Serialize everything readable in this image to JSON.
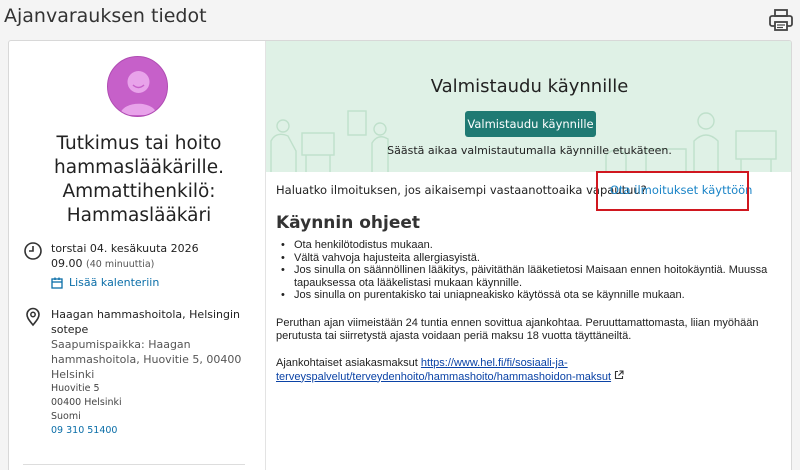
{
  "page": {
    "title": "Ajanvarauksen tiedot"
  },
  "professional": {
    "title": "Tutkimus tai hoito hammaslääkärille. Ammattihenkilö: Hammaslääkäri"
  },
  "appointment": {
    "date": "torstai 04. kesäkuuta 2026",
    "time": "09.00",
    "duration": "(40 minuuttia)",
    "add_calendar": "Lisää kalenteriin"
  },
  "location": {
    "name": "Haagan hammashoitola, Helsingin sotepe",
    "visit_place": "Saapumispaikka: Haagan hammashoitola, Huovitie 5, 00400 Helsinki",
    "street": "Huovitie 5",
    "postal": "00400 Helsinki",
    "country": "Suomi",
    "phone": "09 310 51400"
  },
  "banner": {
    "title": "Valmistaudu käynnille",
    "button": "Valmistaudu käynnille",
    "subtitle": "Säästä aikaa valmistautumalla käynnille etukäteen."
  },
  "notifications": {
    "question": "Haluatko ilmoituksen, jos aikaisempi vastaanottoaika vapautuu?",
    "link": "Ota ilmoitukset käyttöön"
  },
  "instructions": {
    "title": "Käynnin ohjeet",
    "items": [
      "Ota henkilötodistus mukaan.",
      "Vältä vahvoja hajusteita allergiasyistä.",
      "Jos sinulla on säännöllinen lääkitys, päivitäthän lääketietosi Maisaan ennen hoitokäyntiä. Muussa tapauksessa ota lääkelistasi mukaan käynnille.",
      "Jos sinulla on purentakisko tai uniapneakisko käytössä ota se käynnille mukaan."
    ],
    "cancellation": "Peruthan ajan viimeistään 24 tuntia ennen sovittua ajankohtaa. Peruuttamattomasta, liian myöhään perutusta tai siirretystä ajasta voidaan periä maksu 18 vuotta täyttäneiltä.",
    "fees_label": "Ajankohtaiset asiakasmaksut",
    "fees_link": "https://www.hel.fi/fi/sosiaali-ja-terveyspalvelut/terveydenhoito/hammashoito/hammashoidon-maksut"
  },
  "colors": {
    "accent": "#1f7a73",
    "avatar": "#c660c9",
    "banner_bg": "#dff1e6",
    "link": "#1a84c7",
    "highlight": "#d0171f"
  },
  "icons": {
    "print": "printer-icon",
    "clock": "clock-icon",
    "calendar": "calendar-icon",
    "location": "location-pin-icon",
    "external": "external-link-icon",
    "avatar": "person-avatar-icon"
  }
}
